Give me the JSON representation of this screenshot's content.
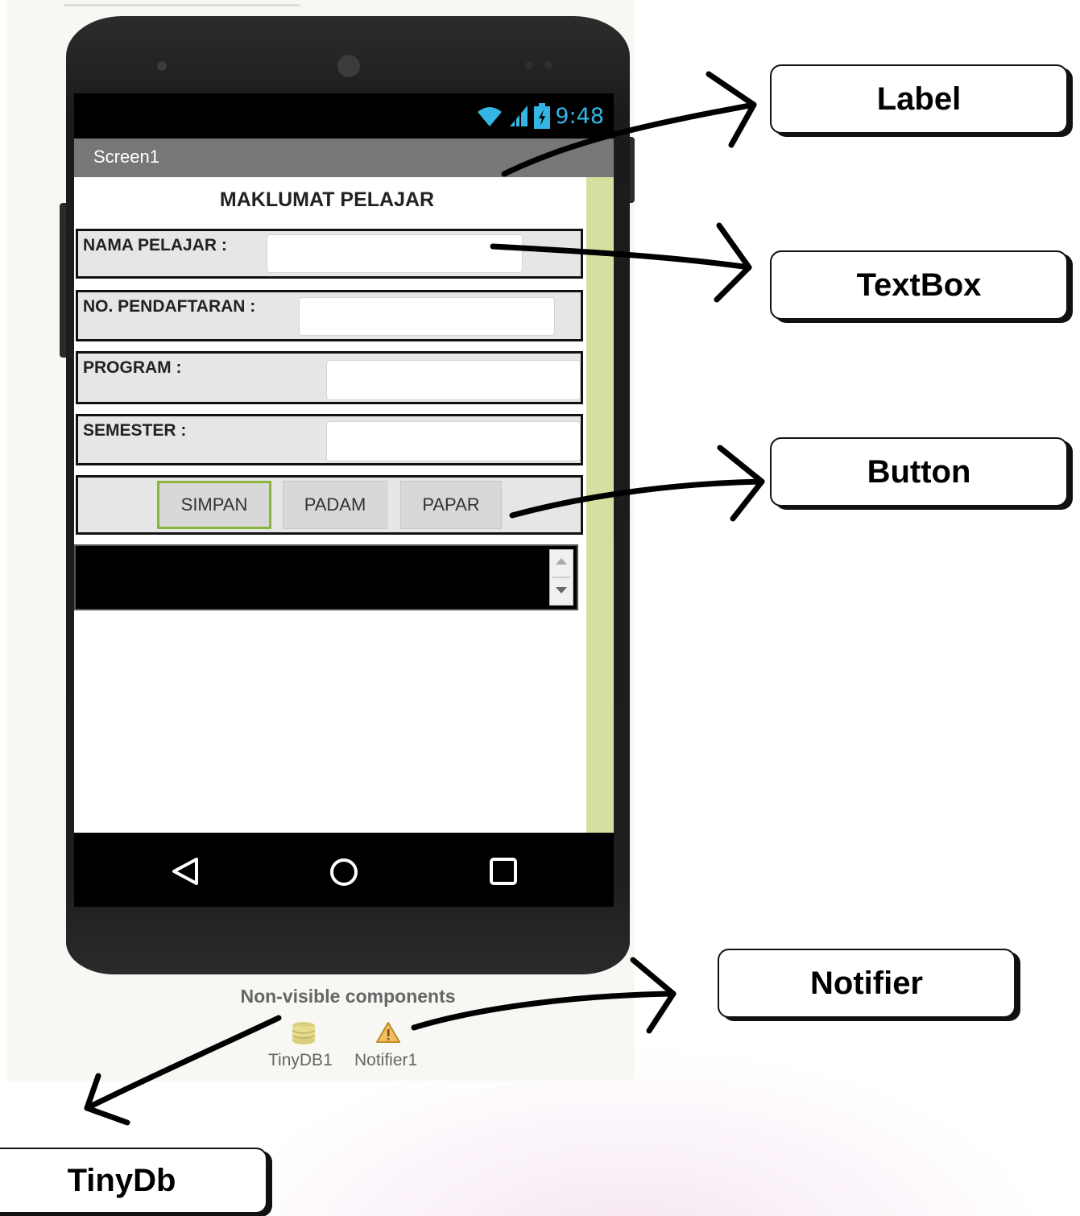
{
  "screen": {
    "title": "Screen1",
    "status_time": "9:48",
    "heading": "MAKLUMAT PELAJAR",
    "fields": [
      {
        "label": "NAMA PELAJAR :",
        "value": ""
      },
      {
        "label": "NO. PENDAFTARAN :",
        "value": ""
      },
      {
        "label": "PROGRAM :",
        "value": ""
      },
      {
        "label": "SEMESTER :",
        "value": ""
      }
    ],
    "buttons": [
      "SIMPAN",
      "PADAM",
      "PAPAR"
    ],
    "selected_button": "SIMPAN"
  },
  "non_visible": {
    "title": "Non-visible components",
    "items": [
      "TinyDB1",
      "Notifier1"
    ]
  },
  "callouts": {
    "label": "Label",
    "textbox": "TextBox",
    "button": "Button",
    "notifier": "Notifier",
    "tinydb": "TinyDb"
  },
  "icons": [
    "wifi-icon",
    "signal-icon",
    "battery-icon",
    "back-icon",
    "home-icon",
    "recent-apps-icon",
    "database-icon",
    "warning-icon"
  ],
  "colors": {
    "status_accent": "#33b5e5",
    "selected_border": "#8ab43a",
    "right_bar": "#d5e0a0"
  }
}
